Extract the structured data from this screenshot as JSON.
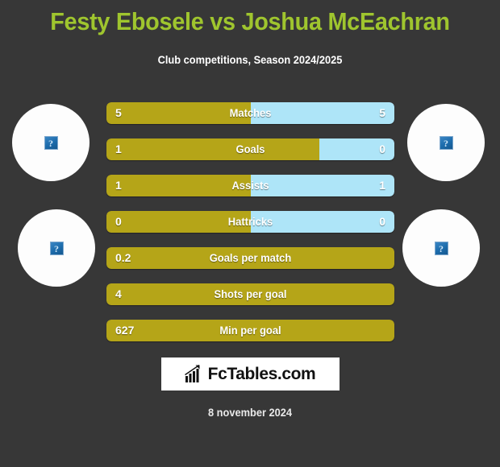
{
  "header": {
    "title": "Festy Ebosele vs Joshua McEachran",
    "subtitle": "Club competitions, Season 2024/2025"
  },
  "colors": {
    "background": "#373737",
    "title_green": "#9fc52e",
    "bar_home_gold": "#b5a518",
    "bar_away_blue": "#aee5f8",
    "text_white": "#ffffff"
  },
  "players": {
    "home": {
      "avatar_icon": "broken-image-icon",
      "avatar_placeholder": "?"
    },
    "away": {
      "avatar_icon": "broken-image-icon",
      "avatar_placeholder": "?"
    }
  },
  "chart_data": {
    "type": "bar",
    "title": "Festy Ebosele vs Joshua McEachran",
    "subtitle": "Club competitions, Season 2024/2025",
    "orientation": "horizontal-diverging",
    "series": [
      {
        "name": "Festy Ebosele",
        "side": "left",
        "color": "#b5a518"
      },
      {
        "name": "Joshua McEachran",
        "side": "right",
        "color": "#aee5f8"
      }
    ],
    "categories": [
      "Matches",
      "Goals",
      "Assists",
      "Hattricks",
      "Goals per match",
      "Shots per goal",
      "Min per goal"
    ],
    "rows": [
      {
        "label": "Matches",
        "left_value": "5",
        "right_value": "5",
        "left_pct": 50,
        "has_right": true
      },
      {
        "label": "Goals",
        "left_value": "1",
        "right_value": "0",
        "left_pct": 74,
        "has_right": true
      },
      {
        "label": "Assists",
        "left_value": "1",
        "right_value": "1",
        "left_pct": 50,
        "has_right": true
      },
      {
        "label": "Hattricks",
        "left_value": "0",
        "right_value": "0",
        "left_pct": 50,
        "has_right": true
      },
      {
        "label": "Goals per match",
        "left_value": "0.2",
        "right_value": "",
        "left_pct": 100,
        "has_right": false
      },
      {
        "label": "Shots per goal",
        "left_value": "4",
        "right_value": "",
        "left_pct": 100,
        "has_right": false
      },
      {
        "label": "Min per goal",
        "left_value": "627",
        "right_value": "",
        "left_pct": 100,
        "has_right": false
      }
    ]
  },
  "footer": {
    "logo_text": "FcTables.com",
    "logo_icon": "bar-chart-arrow-icon",
    "date": "8 november 2024"
  }
}
